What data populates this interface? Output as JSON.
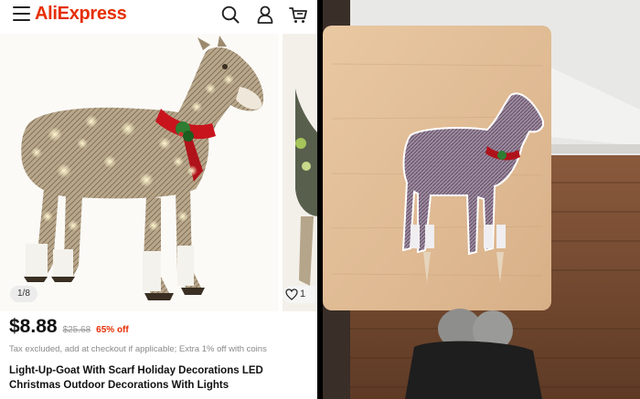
{
  "header": {
    "logo_text": "AliExpress",
    "brand_color": "#e62e04",
    "icons": [
      "menu-icon",
      "search-icon",
      "account-icon",
      "cart-icon"
    ]
  },
  "gallery": {
    "counter": "1/8",
    "wishlist_count": "1"
  },
  "product": {
    "price": "$8.88",
    "original_price": "$25.68",
    "discount": "65% off",
    "tax_note": "Tax excluded, add at checkout if applicable; Extra 1% off with coins",
    "title": "Light-Up-Goat With Scarf Holiday Decorations LED Christmas Outdoor Decorations With Lights"
  }
}
